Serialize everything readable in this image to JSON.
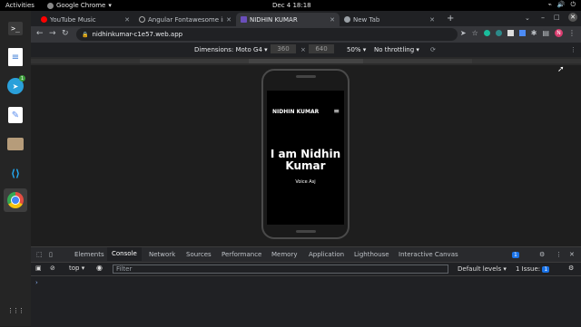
{
  "topbar": {
    "activities": "Activities",
    "app_name": "Google Chrome",
    "app_arrow": "▾",
    "clock": "Dec 4  18:18",
    "tray": [
      "⌁",
      "🔊",
      "⏻"
    ]
  },
  "dock": {
    "items": [
      {
        "name": "terminal-icon",
        "glyph": ">_",
        "color": "#555"
      },
      {
        "name": "text-editor-icon",
        "glyph": "≡",
        "color": "#3a7bd5"
      },
      {
        "name": "telegram-icon",
        "glyph": "➤",
        "color": "#2aa0da",
        "badge": "1"
      },
      {
        "name": "notes-icon",
        "glyph": "✎",
        "color": "#5a8dee"
      },
      {
        "name": "files-icon",
        "glyph": "▭",
        "color": "#b69c7a"
      },
      {
        "name": "vscode-icon",
        "glyph": "⟨⟩",
        "color": "#23a9f2"
      },
      {
        "name": "chrome-icon",
        "glyph": "◉",
        "color": "#e24d42"
      }
    ],
    "grid_glyph": "⋮⋮⋮"
  },
  "tabs": [
    {
      "title": "YouTube Music",
      "fav_color": "#ff0000"
    },
    {
      "title": "Angular Fontawesome in",
      "fav_color": "#333"
    },
    {
      "title": "NIDHIN KUMAR",
      "fav_color": "#6b4fbb"
    },
    {
      "title": "New Tab",
      "fav_color": "#9aa0a6"
    }
  ],
  "toolbar": {
    "back": "←",
    "forward": "→",
    "reload": "↻",
    "url": "nidhinkumar-c1e57.web.app",
    "lock": "🔒",
    "menu": "⋮",
    "profile": "N"
  },
  "devbar": {
    "dimensions_label": "Dimensions: Moto G4 ▾",
    "width": "360",
    "height": "640",
    "times": "×",
    "zoom": "50% ▾",
    "throttle": "No throttling ▾",
    "rotate": "⟳"
  },
  "site": {
    "brand": "NIDHIN KUMAR",
    "menu": "≡",
    "hero": "I am Nidhin Kumar",
    "tagline": "Voice Asj"
  },
  "devtools": {
    "tabs": [
      "Elements",
      "Console",
      "Network",
      "Sources",
      "Performance",
      "Memory",
      "Application",
      "Lighthouse",
      "Interactive Canvas"
    ],
    "active_tab": "Console",
    "issues_badge": "1",
    "context": "top",
    "filter_placeholder": "Filter",
    "levels": "Default levels ▾",
    "issue_text": "1 Issue:",
    "issue_count": "1",
    "prompt": "›"
  }
}
